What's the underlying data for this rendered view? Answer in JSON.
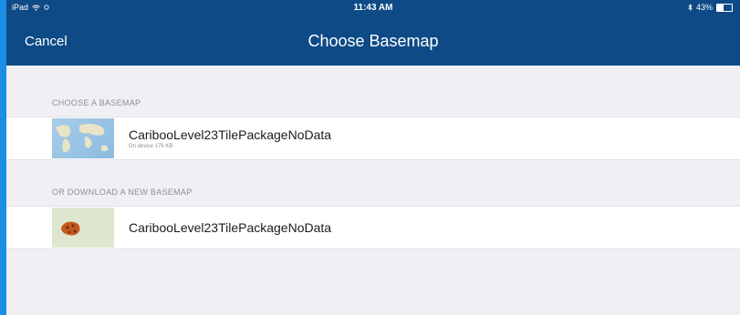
{
  "status_bar": {
    "left": "iPad",
    "time": "11:43 AM",
    "battery_percent": "43%",
    "battery_level": 0.43
  },
  "nav": {
    "cancel_label": "Cancel",
    "title": "Choose Basemap"
  },
  "sections": [
    {
      "header": "CHOOSE A BASEMAP",
      "items": [
        {
          "title": "CaribooLevel23TilePackageNoData",
          "subtitle": "On device 176 KB",
          "thumbnail_icon": "world-map-thumbnail"
        }
      ]
    },
    {
      "header": "OR DOWNLOAD A NEW BASEMAP",
      "items": [
        {
          "title": "CaribooLevel23TilePackageNoData",
          "subtitle": "",
          "thumbnail_icon": "region-map-thumbnail"
        }
      ]
    }
  ],
  "colors": {
    "bar": "#0d4a86",
    "background": "#efeff4",
    "frame": "#1a8fe3"
  }
}
